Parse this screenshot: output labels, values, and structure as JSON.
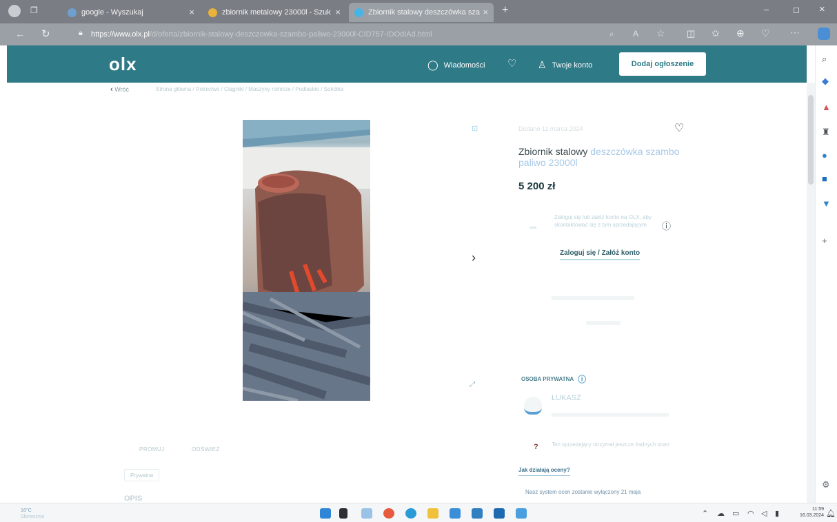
{
  "browser": {
    "tabs": [
      {
        "label": "google - Wyszukaj",
        "active": false
      },
      {
        "label": "zbiornik metalowy 23000l - Szuk",
        "active": false
      },
      {
        "label": "Zbiornik stalowy deszczówka sza",
        "active": true
      }
    ],
    "new_tab": "+",
    "url_host": "https://www.olx.pl",
    "url_path": "/d/oferta/zbiornik-stalowy-deszczowka-szambo-paliwo-23000l-CID757-IDOdIAd.html"
  },
  "header": {
    "logo": "olx",
    "messages_label": "Wiadomości",
    "account_label": "Twoje konto",
    "post_ad_label": "Dodaj ogłoszenie"
  },
  "breadcrumb": {
    "back_label": "Wróć",
    "path": "Strona główna / Rolnictwo / Ciągniki / Maszyny rolnicze / Podlaskie / Sokółka"
  },
  "listing": {
    "date": "Dodane 11 marca 2024",
    "title_main": "Zbiornik stalowy",
    "title_rest": " deszczówka szambo paliwo 23000l",
    "price": "5 200 zł",
    "login_prompt": "Zaloguj się lub załóż konto na OLX, aby skontaktować się z tym sprzedającym",
    "login_link": "Zaloguj się / Załóż konto",
    "seller_type": "OSOBA PRYWATNA",
    "seller_name": "ŁUKASZ",
    "rating_text": "Ten sprzedający otrzymał jeszcze żadnych ocen",
    "rating_link": "Jak działają oceny?",
    "rating_notice": "Nasz system ocen zostanie wyłączony 21 maja"
  },
  "actions": {
    "promote_label": "PROMUJ",
    "refresh_label": "ODŚWIEŻ",
    "tag_private": "Prywatne",
    "description_heading": "OPIS"
  },
  "taskbar": {
    "weather": "16°C",
    "weather_sub": "Słonecznie",
    "time": "11:59",
    "date": "16.03.2024"
  },
  "colors": {
    "olx_teal": "#2f7a87",
    "browser_chrome": "#9aa0a6",
    "accent_blue": "#5aa0d2"
  },
  "icons": {
    "messages": "chat-bubble-icon",
    "favorites": "heart-icon",
    "account": "user-icon",
    "next": "chevron-right-icon",
    "fullscreen": "expand-icon",
    "info": "info-circle-icon"
  }
}
